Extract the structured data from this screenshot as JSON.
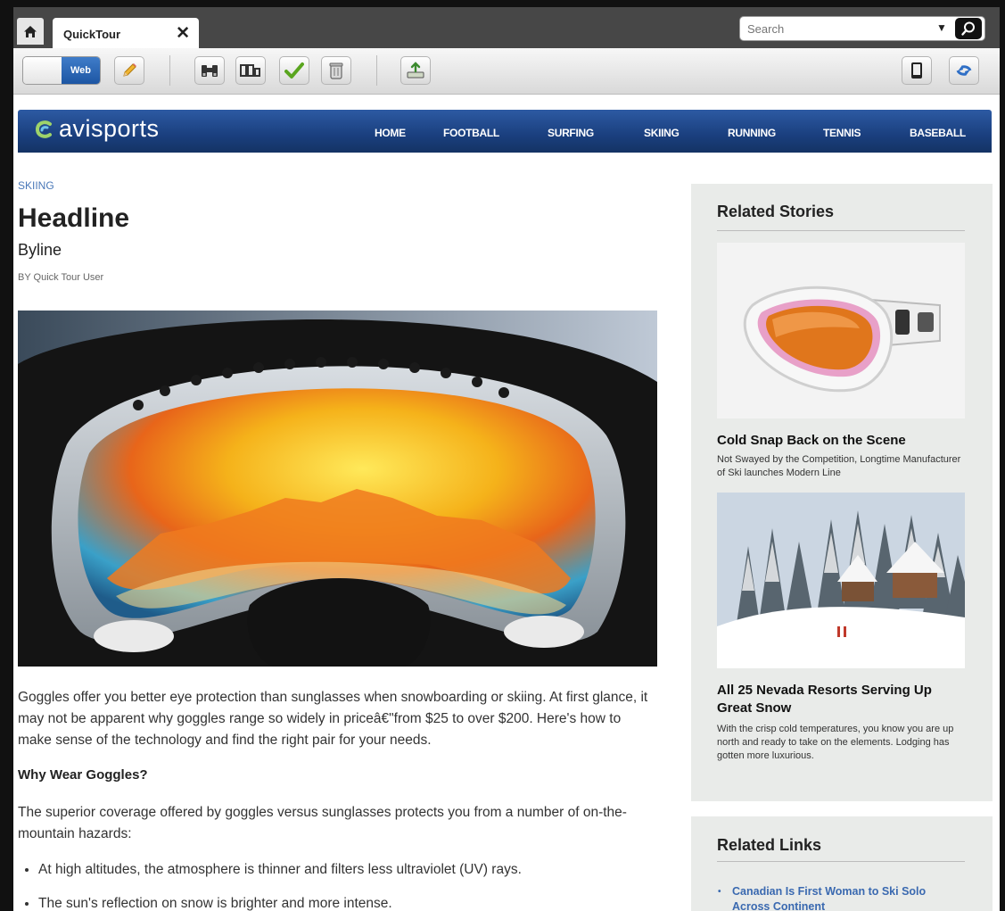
{
  "browser": {
    "tab_label": "QuickTour",
    "search_placeholder": "Search"
  },
  "toolbar": {
    "toggle_on_label": "Web"
  },
  "site": {
    "logo_text": "avisports",
    "nav": [
      "HOME",
      "FOOTBALL",
      "SURFING",
      "SKIING",
      "RUNNING",
      "TENNIS",
      "BASEBALL"
    ]
  },
  "article": {
    "section": "SKIING",
    "headline": "Headline",
    "byline": "Byline",
    "author": "BY Quick Tour User",
    "paragraph1": "Goggles offer you better eye protection than sunglasses when snowboarding or skiing. At first glance, it may not be apparent why goggles range so widely in priceâ€\"from $25 to over $200. Here's how to make sense of the technology and find the right pair for your needs.",
    "subhead": "Why Wear Goggles?",
    "paragraph2": "The superior coverage offered by goggles versus sunglasses protects you from a number of on-the-mountain hazards:",
    "bullets": [
      "At high altitudes, the atmosphere is thinner and filters less ultraviolet (UV) rays.",
      "The sun's reflection on snow is brighter and more intense."
    ]
  },
  "sidebar": {
    "related_stories_title": "Related Stories",
    "stories": [
      {
        "title": "Cold Snap Back on the Scene",
        "desc": "Not Swayed by the Competition, Longtime Manufacturer of Ski launches Modern Line"
      },
      {
        "title": "All 25 Nevada Resorts Serving Up Great Snow",
        "desc": "With the crisp cold temperatures, you know you are up north and ready to take on the elements. Lodging has gotten more luxurious."
      }
    ],
    "related_links_title": "Related Links",
    "links": [
      "Canadian Is First Woman to Ski Solo Across Continent"
    ]
  },
  "colors": {
    "nav_blue": "#1a3f7e",
    "link_blue": "#3a69b0",
    "toggle_blue": "#2a66b8",
    "sidebar_bg": "#e9ebe9"
  }
}
